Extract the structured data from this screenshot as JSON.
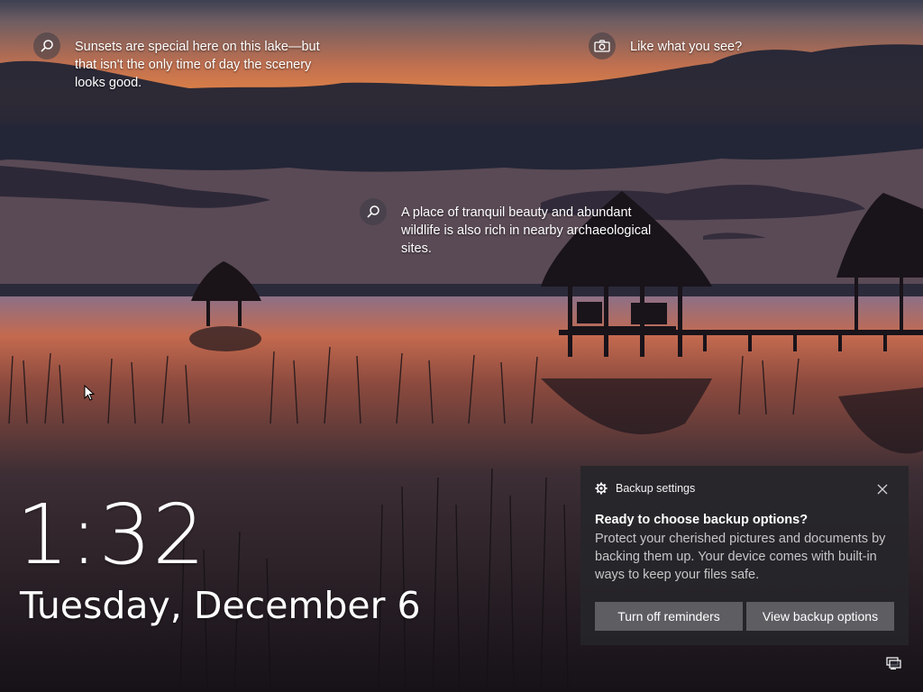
{
  "lockscreen": {
    "time": "1:32",
    "date": "Tuesday, December 6"
  },
  "spotlight": {
    "hints": [
      {
        "icon": "search-icon",
        "text": "Sunsets are special here on this lake—but that isn't the only time of day the scenery looks good."
      },
      {
        "icon": "camera-icon",
        "text": "Like what you see?"
      },
      {
        "icon": "search-icon",
        "text": "A place of tranquil beauty and abundant wildlife is also rich in nearby archaeological sites."
      }
    ]
  },
  "toast": {
    "app_icon": "gear-icon",
    "app_name": "Backup settings",
    "title": "Ready to choose backup options?",
    "body": "Protect your cherished pictures and documents by backing them up. Your device comes with built-in ways to keep your files safe.",
    "buttons": [
      "Turn off reminders",
      "View backup options"
    ]
  },
  "tray": {
    "icon": "network-icon"
  }
}
